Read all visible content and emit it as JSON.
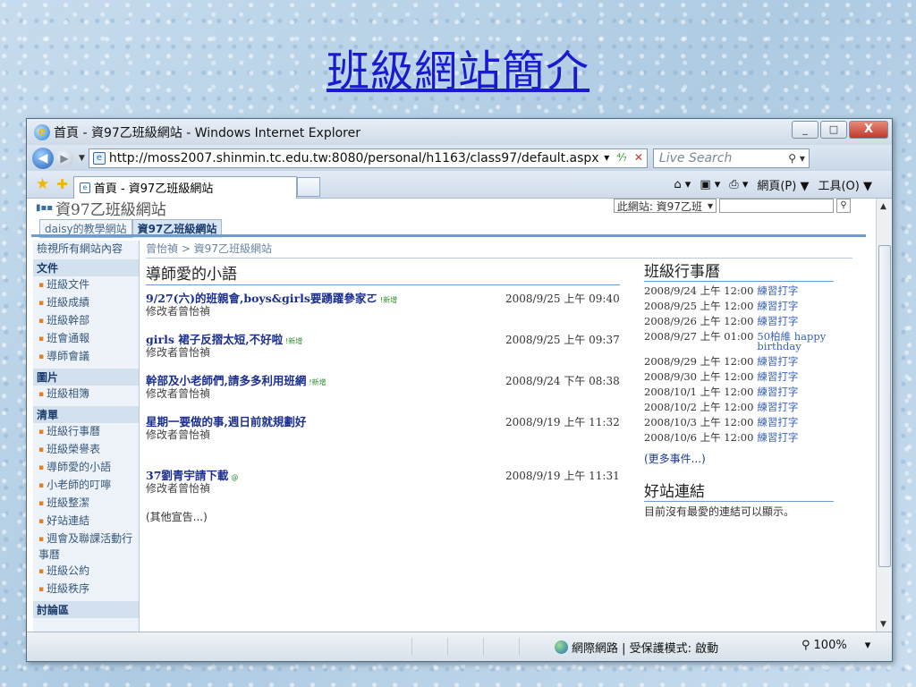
{
  "slide": {
    "title": "班級網站簡介"
  },
  "window": {
    "title": "首頁 - 資97乙班級網站 - Windows Internet Explorer",
    "min": "_",
    "max": "□",
    "close": "X"
  },
  "address": {
    "url": "http://moss2007.shinmin.tc.edu.tw:8080/personal/h1163/class97/default.aspx",
    "search_placeholder": "Live Search"
  },
  "tabbar": {
    "tab_title": "首頁 - 資97乙班級網站",
    "page_menu": "網頁(P) ▼",
    "tools_menu": "工具(O) ▼"
  },
  "site": {
    "title": "資97乙班級網站",
    "search_scope": "此網站: 資97乙班",
    "tabs": [
      {
        "label": "daisy的教學網站"
      },
      {
        "label": "資97乙班級網站"
      }
    ]
  },
  "leftnav": {
    "view_all": "檢視所有網站內容",
    "docs_header": "文件",
    "docs": [
      "班級文件",
      "班級成績",
      "班級幹部",
      "班會通報",
      "導師會議"
    ],
    "pics_header": "圖片",
    "pics": [
      "班級相簿"
    ],
    "lists_header": "清單",
    "lists": [
      "班級行事曆",
      "班級榮譽表",
      "導師愛的小語",
      "小老師的叮嚀",
      "班級整潔",
      "好站連結",
      "週會及聯課活動行事曆",
      "班級公約",
      "班級秩序"
    ],
    "disc_header": "討論區"
  },
  "main": {
    "breadcrumb": "曾怡禎 > 資97乙班級網站",
    "announcements_title": "導師愛的小語",
    "announcements": [
      {
        "title": "9/27(六)的班親會,boys&girls要踴躍參家ㄛ",
        "new": "!新增",
        "modified": "修改者曾怡禎",
        "date": "2008/9/25 上午 09:40"
      },
      {
        "title": "girls 裙子反摺太短,不好啦",
        "new": "!新增",
        "modified": "修改者曾怡禎",
        "date": "2008/9/25 上午 09:37"
      },
      {
        "title": "幹部及小老師們,請多多利用班網",
        "new": "!新增",
        "modified": "修改者曾怡禎",
        "date": "2008/9/24 下午 08:38"
      },
      {
        "title": "星期一要做的事,週日前就規劃好",
        "new": "",
        "modified": "修改者曾怡禎",
        "date": "2008/9/19 上午 11:32"
      },
      {
        "title": "37劉青宇請下載",
        "new": "@",
        "modified": "修改者曾怡禎",
        "date": "2008/9/19 上午 11:31"
      }
    ],
    "more": "(其他宣告...)"
  },
  "calendar": {
    "title": "班級行事曆",
    "events": [
      {
        "date": "2008/9/24 上午 12:00",
        "name": "練習打字"
      },
      {
        "date": "2008/9/25 上午 12:00",
        "name": "練習打字"
      },
      {
        "date": "2008/9/26 上午 12:00",
        "name": "練習打字"
      },
      {
        "date": "2008/9/27 上午 01:00",
        "name": "50柏維 happy birthday"
      },
      {
        "date": "2008/9/29 上午 12:00",
        "name": "練習打字"
      },
      {
        "date": "2008/9/30 上午 12:00",
        "name": "練習打字"
      },
      {
        "date": "2008/10/1 上午 12:00",
        "name": "練習打字"
      },
      {
        "date": "2008/10/2 上午 12:00",
        "name": "練習打字"
      },
      {
        "date": "2008/10/3 上午 12:00",
        "name": "練習打字"
      },
      {
        "date": "2008/10/6 上午 12:00",
        "name": "練習打字"
      }
    ],
    "more": "(更多事件...)"
  },
  "links": {
    "title": "好站連結",
    "empty": "目前沒有最愛的連結可以顯示。"
  },
  "status": {
    "zone": "網際網路 | 受保護模式: 啟動",
    "zoom": "100%"
  }
}
